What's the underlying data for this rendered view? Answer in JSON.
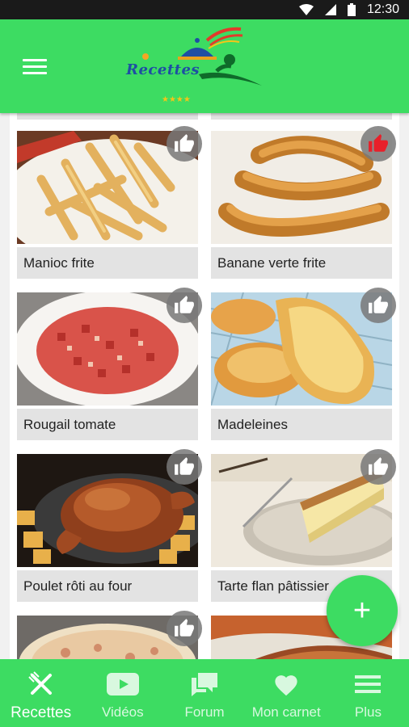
{
  "status": {
    "time": "12:30"
  },
  "header": {
    "logo_text": "Recettes"
  },
  "recipes": [
    {
      "title": "Manioc frite",
      "liked": false
    },
    {
      "title": "Banane verte frite",
      "liked": true
    },
    {
      "title": "Rougail tomate",
      "liked": false
    },
    {
      "title": "Madeleines",
      "liked": false
    },
    {
      "title": "Poulet rôti au four",
      "liked": false
    },
    {
      "title": "Tarte flan pâtissier",
      "liked": false
    },
    {
      "title": "",
      "liked": false
    },
    {
      "title": "",
      "liked": false
    }
  ],
  "fab": {
    "icon": "plus-icon"
  },
  "bottom_nav": [
    {
      "label": "Recettes",
      "icon": "fork-knife-icon",
      "active": true
    },
    {
      "label": "Vidéos",
      "icon": "youtube-icon",
      "active": false
    },
    {
      "label": "Forum",
      "icon": "chat-icon",
      "active": false
    },
    {
      "label": "Mon carnet",
      "icon": "heart-icon",
      "active": false
    },
    {
      "label": "Plus",
      "icon": "menu-icon",
      "active": false
    }
  ],
  "colors": {
    "primary": "#3ddc62",
    "like_active": "#e8202a",
    "status_bar": "#1a1a1a"
  }
}
